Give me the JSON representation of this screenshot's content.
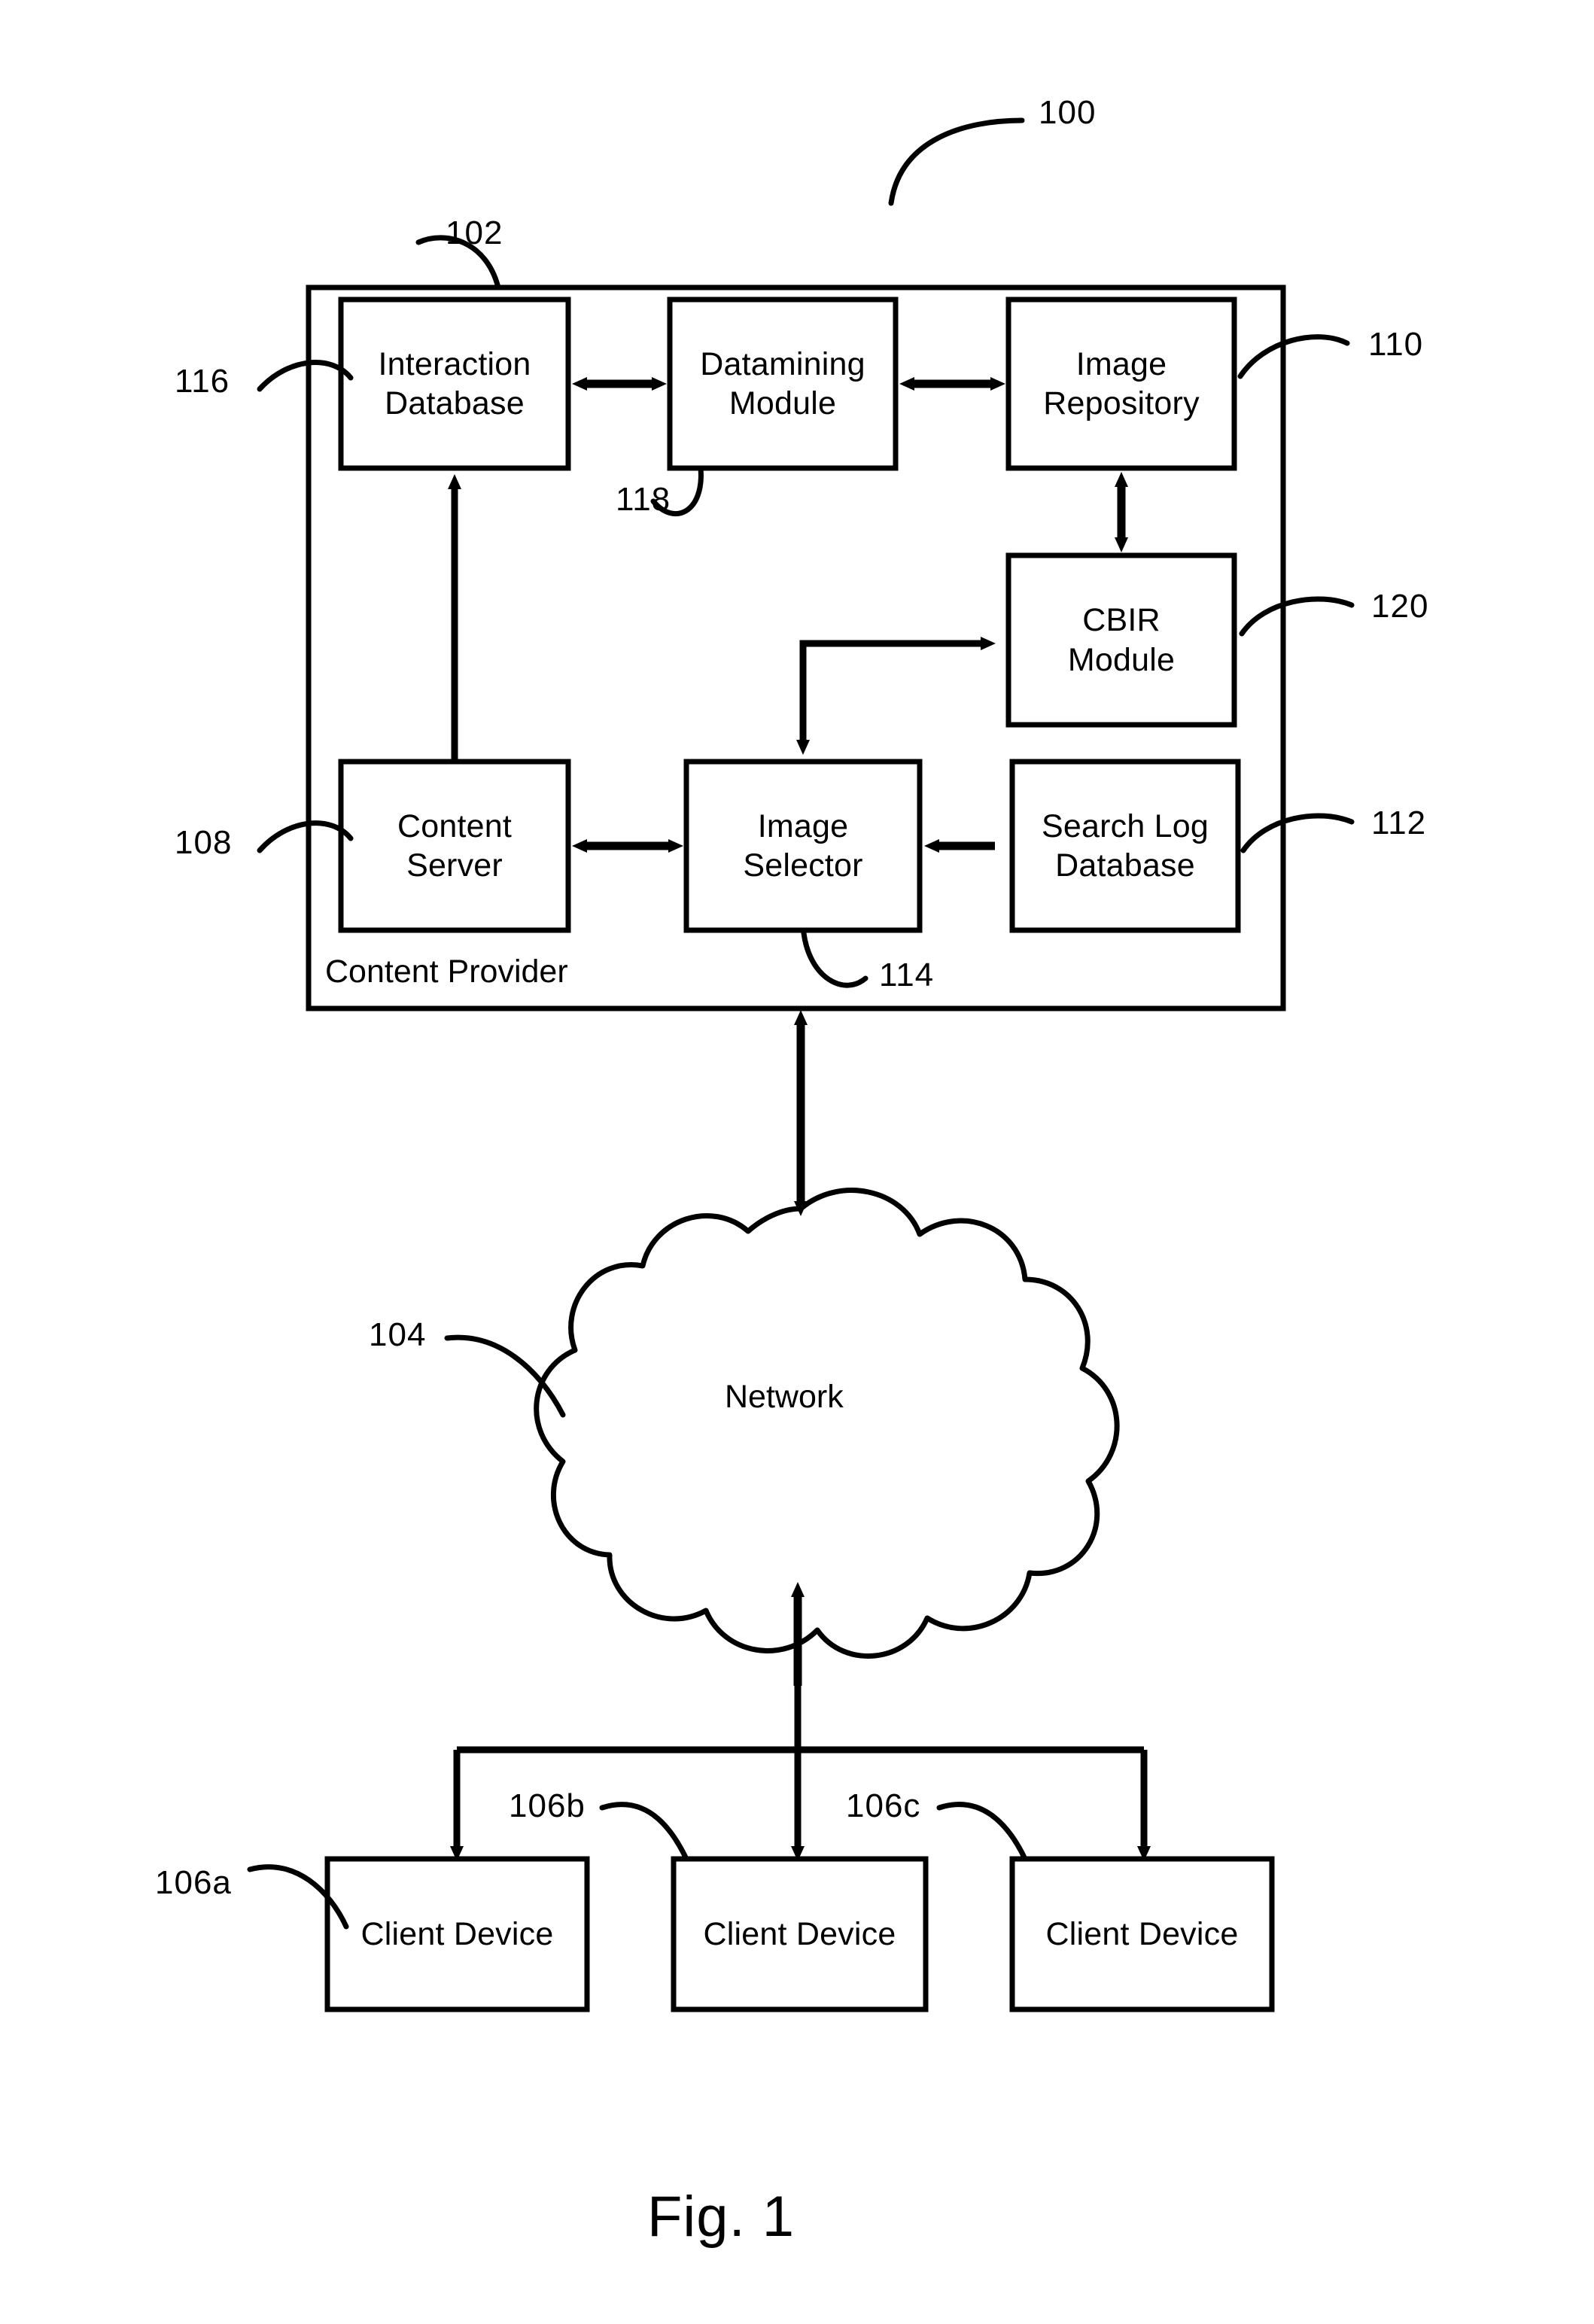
{
  "figure": {
    "caption": "Fig. 1",
    "system_ref": "100"
  },
  "content_provider": {
    "label": "Content Provider",
    "ref": "102",
    "modules": [
      {
        "id": "interaction-database",
        "label": "Interaction\nDatabase",
        "ref": "116"
      },
      {
        "id": "datamining-module",
        "label": "Datamining\nModule",
        "ref": "118"
      },
      {
        "id": "image-repository",
        "label": "Image\nRepository",
        "ref": "110"
      },
      {
        "id": "cbir-module",
        "label": "CBIR\nModule",
        "ref": "120"
      },
      {
        "id": "content-server",
        "label": "Content\nServer",
        "ref": "108"
      },
      {
        "id": "image-selector",
        "label": "Image\nSelector",
        "ref": "114"
      },
      {
        "id": "search-log-database",
        "label": "Search Log\nDatabase",
        "ref": "112"
      }
    ]
  },
  "network": {
    "label": "Network",
    "ref": "104"
  },
  "clients": [
    {
      "id": "client-device-a",
      "label": "Client Device",
      "ref": "106a"
    },
    {
      "id": "client-device-b",
      "label": "Client Device",
      "ref": "106b"
    },
    {
      "id": "client-device-c",
      "label": "Client Device",
      "ref": "106c"
    }
  ],
  "colors": {
    "line": "#000000",
    "background": "#ffffff"
  }
}
